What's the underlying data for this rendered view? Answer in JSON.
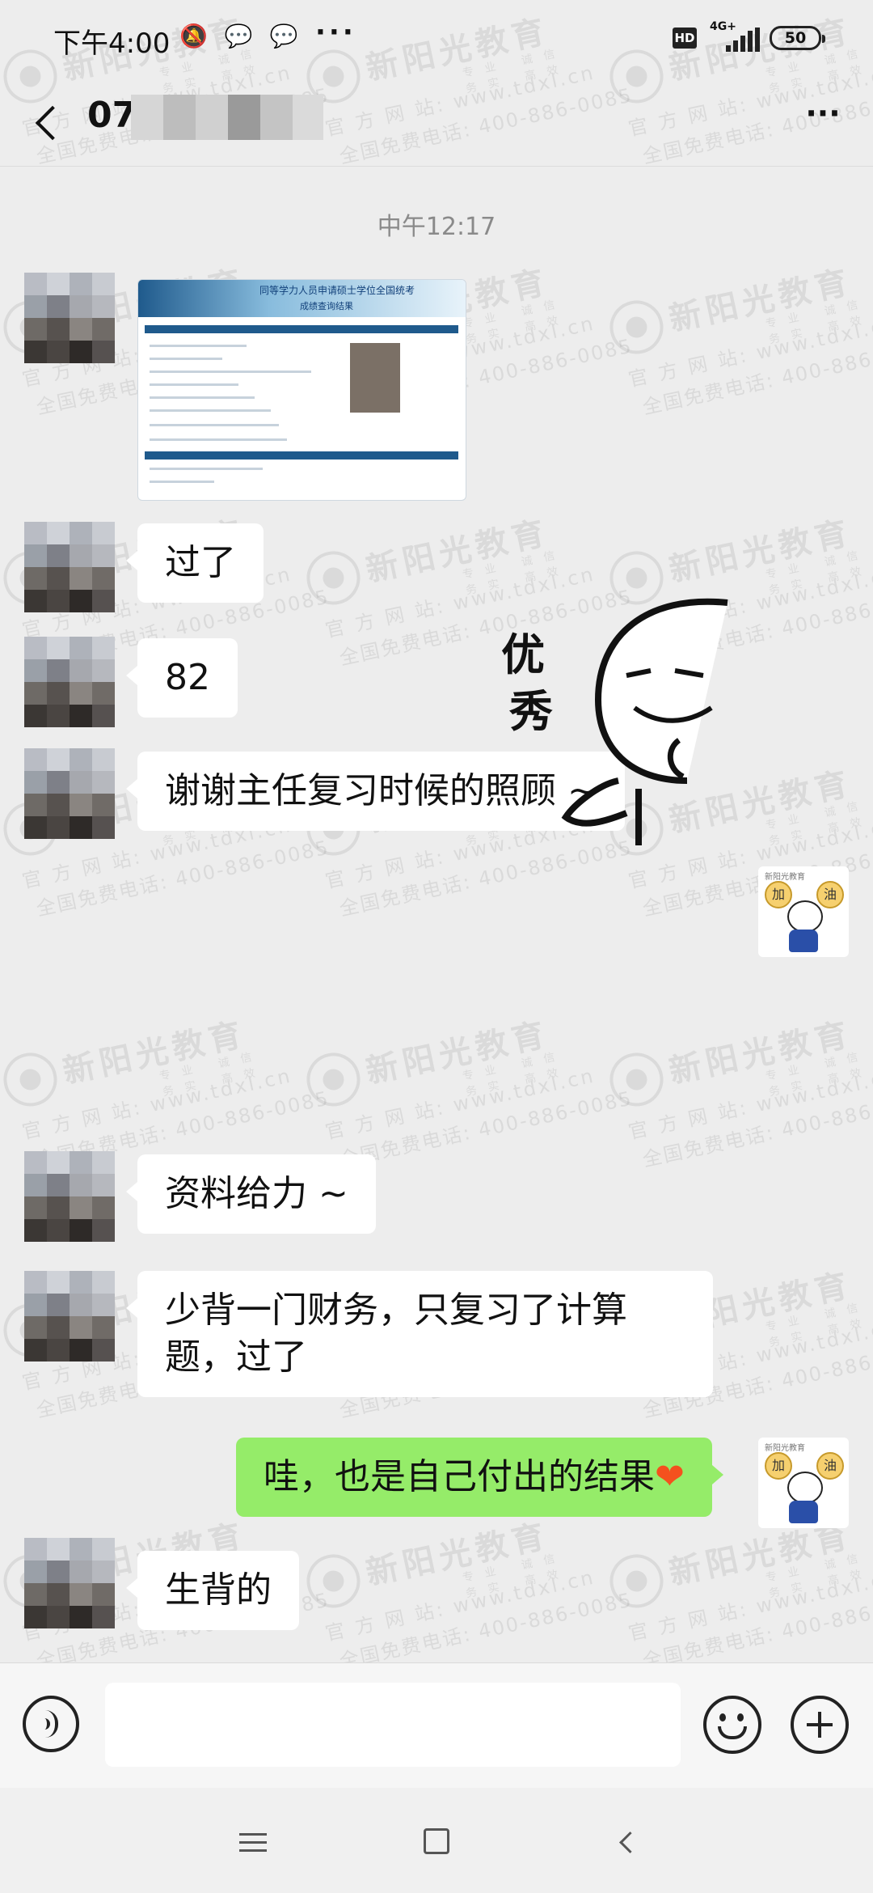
{
  "status_bar": {
    "time": "下午4:00",
    "notification_icons": "🔕 💬 💬",
    "more_dots": "···",
    "hd": "HD",
    "network": "4G+",
    "battery": "50"
  },
  "header": {
    "title": "07",
    "more": "···"
  },
  "watermark": {
    "brand": "新阳光教育",
    "tagline": "专业 诚信 务实 高效",
    "site": "官 方 网 站: www.tdxl.cn",
    "phone": "全国免费电话: 400-886-0085"
  },
  "chat": {
    "timestamp": "中午12:17",
    "image_card": {
      "title": "同等学力人员申请硕士学位全国统考",
      "subtitle": "成绩查询结果"
    },
    "sticker_text_1": "优",
    "sticker_text_2": "秀",
    "messages": [
      {
        "text": "过了"
      },
      {
        "text": "82"
      },
      {
        "text": "谢谢主任复习时候的照顾 ~"
      },
      {
        "text": "资料给力 ~"
      },
      {
        "text": "少背一门财务，只复习了计算题，过了"
      },
      {
        "text": "哇，也是自己付出的结果",
        "emoji": "❤"
      },
      {
        "text": "生背的"
      }
    ],
    "my_avatar_caption": "新阳光教育",
    "my_avatar_chars": [
      "加",
      "油"
    ]
  },
  "input": {
    "placeholder": ""
  },
  "colors": {
    "background": "#ededed",
    "outgoing_bubble": "#95ec69",
    "incoming_bubble": "#ffffff",
    "heart": "#f4511e"
  }
}
